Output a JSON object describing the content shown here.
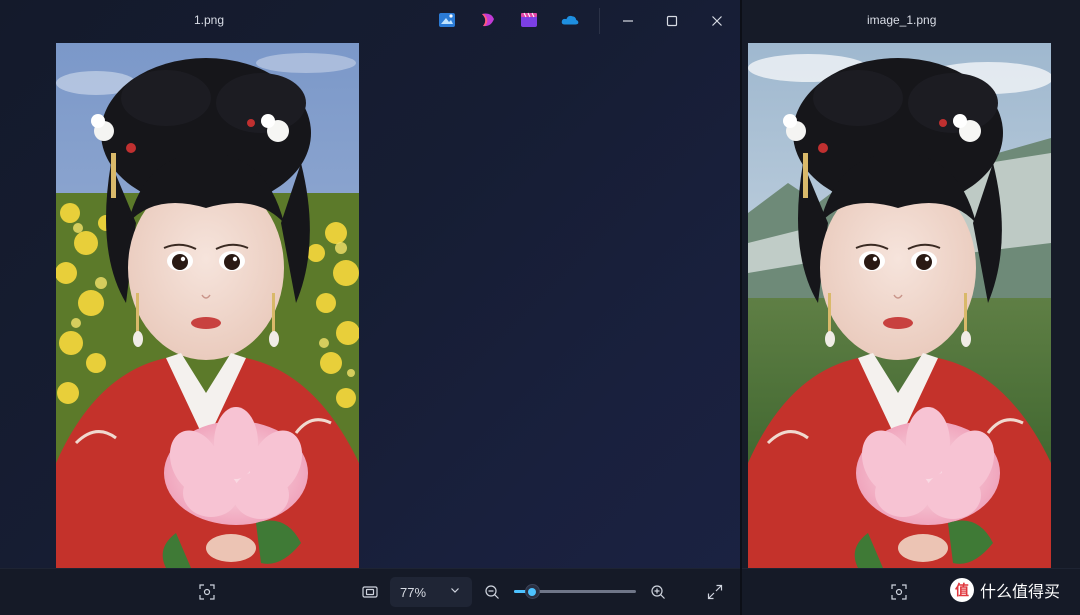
{
  "left_window": {
    "title": "1.png",
    "taskbar_apps": [
      "photos-app-icon",
      "clipchamp-icon",
      "video-editor-icon",
      "onedrive-icon"
    ],
    "controls": [
      "minimize-icon",
      "maximize-icon",
      "close-icon"
    ],
    "toolbar": {
      "crop_button": "crop-capture-icon",
      "fit_button": "fit-to-window-icon",
      "zoom_level": "77%",
      "zoom_slider_percent": 15,
      "fullscreen_button": "fullscreen-icon"
    }
  },
  "right_window": {
    "title": "image_1.png",
    "toolbar": {
      "crop_button": "crop-capture-icon"
    }
  },
  "watermark": {
    "badge": "值",
    "text": "什么值得买"
  },
  "colors": {
    "accent": "#4cc2ff",
    "dress_red": "#c4322b",
    "lotus_pink": "#f2b3c6"
  }
}
